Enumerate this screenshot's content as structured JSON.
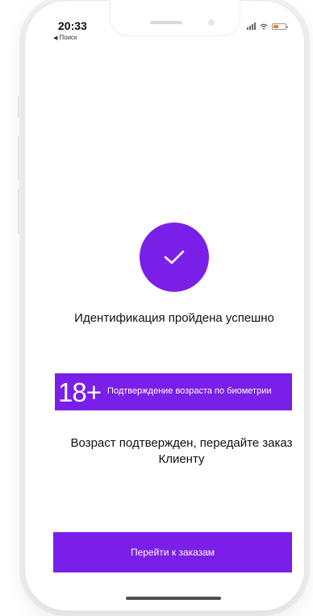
{
  "status_bar": {
    "time": "20:33",
    "back_label": "Поиск",
    "back_arrow": "◀"
  },
  "content": {
    "title": "Идентификация пройдена успешно",
    "age_banner": {
      "badge": "18+",
      "text": "Подтверждение возраста по биометрии"
    },
    "message": "Возраст подтвержден, передайте заказ Клиенту"
  },
  "actions": {
    "primary_label": "Перейти к заказам"
  },
  "colors": {
    "accent": "#7a1fe8",
    "battery": "#f07a22",
    "text": "#111111"
  },
  "icons": {
    "success": "checkmark-icon",
    "wifi": "wifi-icon",
    "signal": "signal-icon",
    "battery": "battery-icon",
    "back": "back-arrow-icon"
  }
}
